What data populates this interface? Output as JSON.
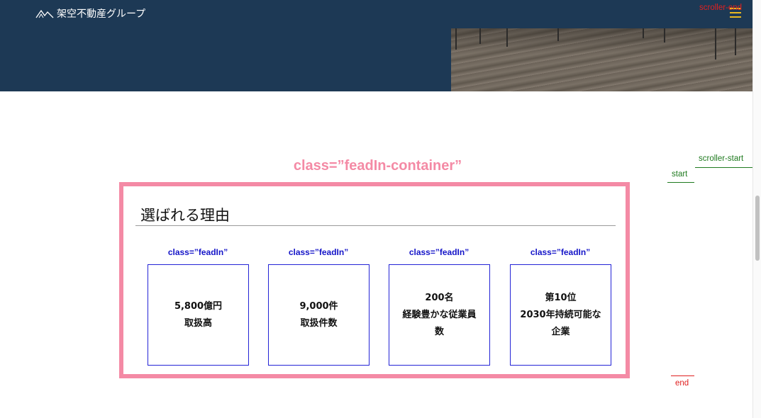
{
  "header": {
    "logo_text": "架空不動産グループ",
    "menu_icon": "hamburger-menu-icon"
  },
  "markers": {
    "scroller_end": "scroller-end",
    "scroller_start": "scroller-start",
    "start": "start",
    "end": "end"
  },
  "container": {
    "class_label": "class=”feadIn-container”",
    "title": "選ばれる理由"
  },
  "cards": [
    {
      "class_label": "class=”feadIn”",
      "lines": [
        "5,800億円",
        "取扱高"
      ]
    },
    {
      "class_label": "class=”feadIn”",
      "lines": [
        "9,000件",
        "取扱件数"
      ]
    },
    {
      "class_label": "class=”feadIn”",
      "lines": [
        "200名",
        "経験豊かな従業員",
        "数"
      ]
    },
    {
      "class_label": "class=”feadIn”",
      "lines": [
        "第10位",
        "2030年持続可能な",
        "企業"
      ]
    }
  ],
  "colors": {
    "header_bg": "#1d3955",
    "container_border": "#f48aa5",
    "card_border": "#2323d6",
    "scroller_end": "#e02020",
    "scroller_start": "#1f7a1f"
  }
}
